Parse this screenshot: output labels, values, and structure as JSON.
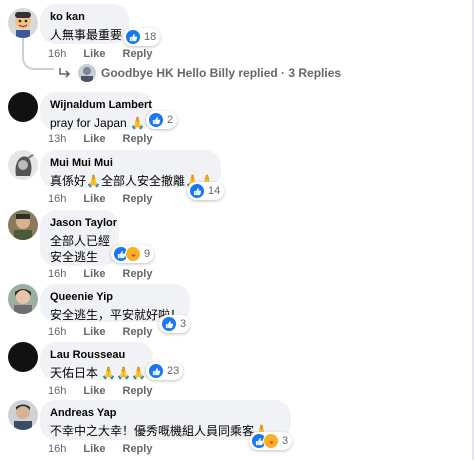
{
  "comments": [
    {
      "author": "ko kan",
      "text": "人無事最重要",
      "reaction_count": "18",
      "time": "16h",
      "like_label": "Like",
      "reply_label": "Reply"
    },
    {
      "author": "Wijnaldum Lambert",
      "text": "pray for Japan",
      "emoji": "🙏",
      "reaction_count": "2",
      "time": "13h",
      "like_label": "Like",
      "reply_label": "Reply"
    },
    {
      "author": "Mui Mui Mui",
      "text_a": "真係好",
      "emoji_a": "🙏",
      "text_b": "全部人安全撤離",
      "emoji_b": "🙏🙏",
      "reaction_count": "14",
      "time": "16h",
      "like_label": "Like",
      "reply_label": "Reply"
    },
    {
      "author": "Jason Taylor",
      "text_line1": "全部人已經",
      "text_line2": "安全逃生",
      "reaction_count": "9",
      "time": "16h",
      "like_label": "Like",
      "reply_label": "Reply"
    },
    {
      "author": "Queenie Yip",
      "text": "安全逃生，平安就好啦！",
      "reaction_count": "3",
      "time": "16h",
      "like_label": "Like",
      "reply_label": "Reply"
    },
    {
      "author": "Lau Rousseau",
      "text": "天佑日本",
      "emoji": "🙏🙏🙏",
      "reaction_count": "23",
      "time": "16h",
      "like_label": "Like",
      "reply_label": "Reply"
    },
    {
      "author": "Andreas Yap",
      "text": "不幸中之大幸！優秀嘅機組人員同乘客",
      "emoji": "🙏",
      "reaction_count": "3",
      "time": "16h",
      "like_label": "Like",
      "reply_label": "Reply"
    }
  ],
  "replies_summary": {
    "text": "Goodbye HK Hello Billy replied · 3 Replies"
  },
  "colors": {
    "like_blue": "#1877f2",
    "care_yellow": "#f7b125",
    "bubble_gray": "#f0f2f5",
    "meta_gray": "#65676b"
  },
  "icons": [
    "like-icon",
    "care-icon",
    "reply-arrow-icon",
    "avatar"
  ]
}
